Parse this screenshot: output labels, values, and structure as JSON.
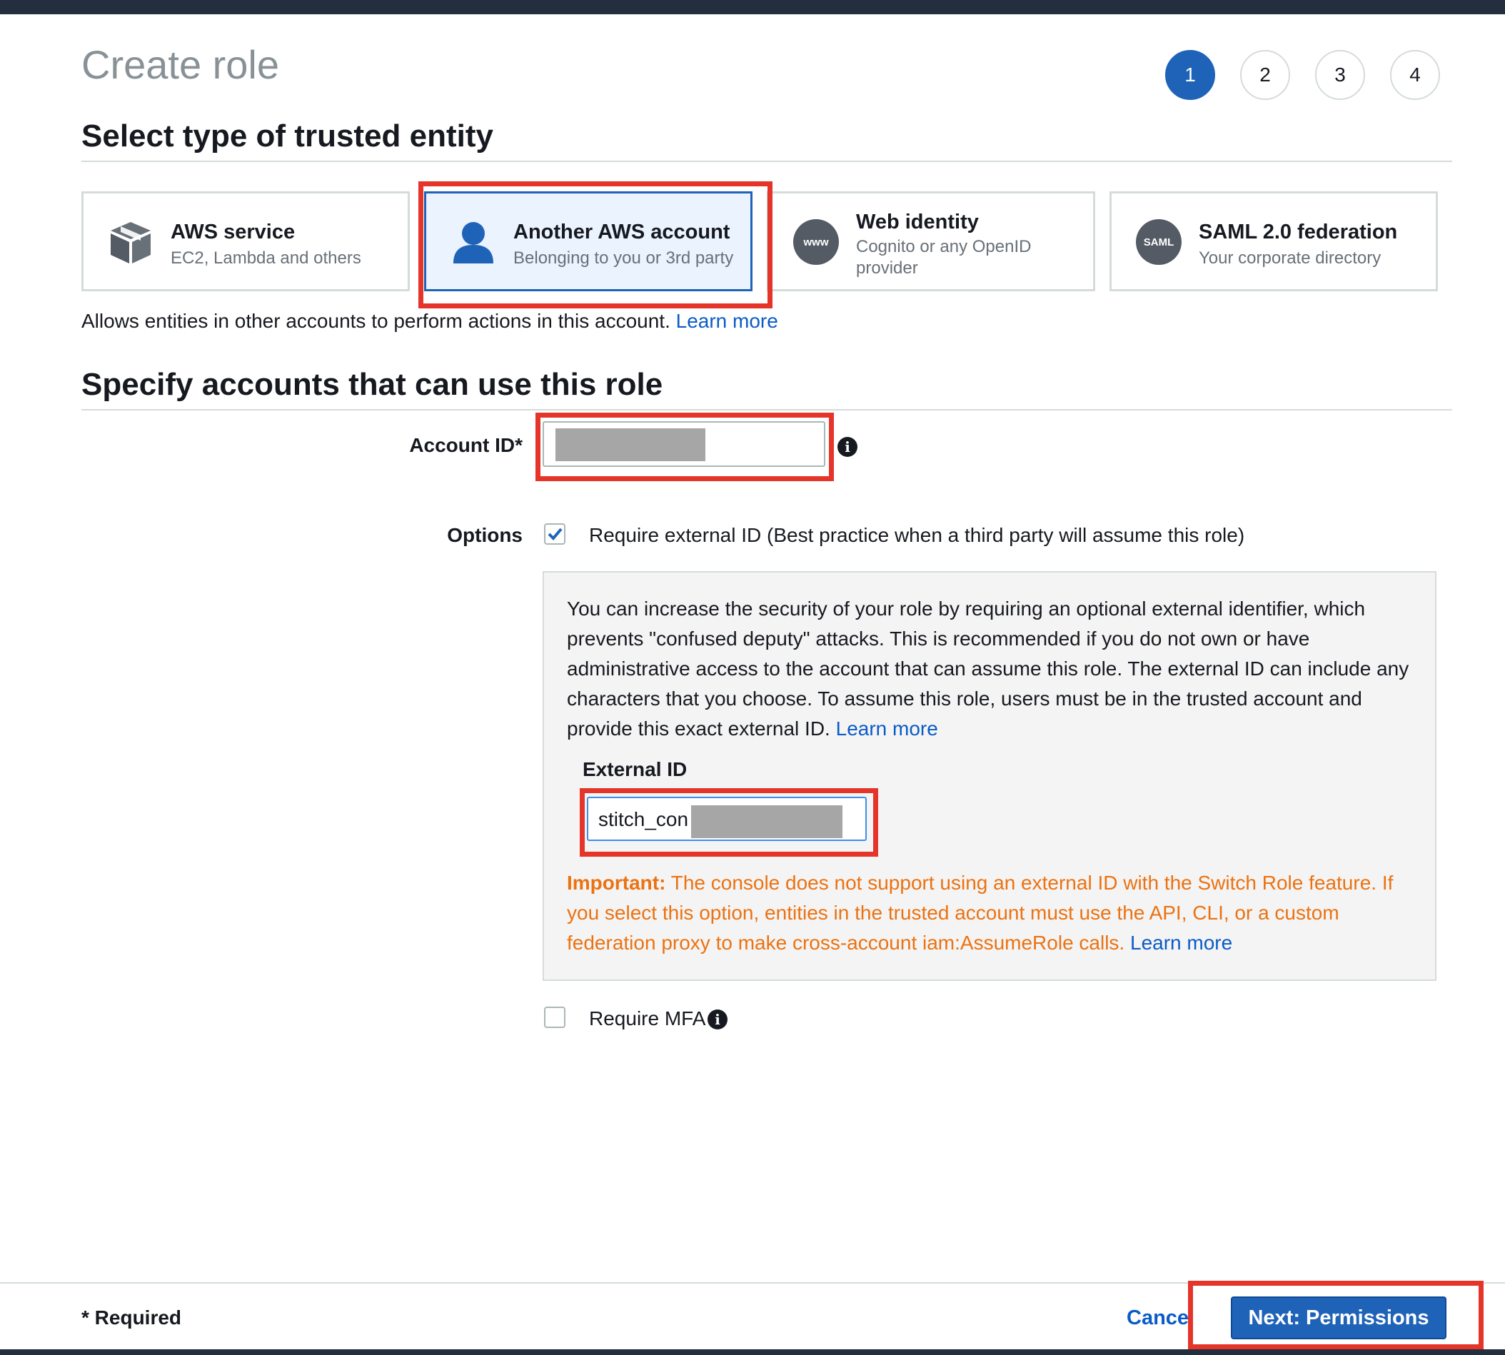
{
  "page": {
    "title": "Create role",
    "steps": [
      "1",
      "2",
      "3",
      "4"
    ],
    "active_step": "1"
  },
  "trusted_entity": {
    "heading": "Select type of trusted entity",
    "options": [
      {
        "title": "AWS service",
        "subtitle": "EC2, Lambda and others",
        "icon": "cube-icon",
        "selected": false
      },
      {
        "title": "Another AWS account",
        "subtitle": "Belonging to you or 3rd party",
        "icon": "user-icon",
        "selected": true
      },
      {
        "title": "Web identity",
        "subtitle": "Cognito or any OpenID",
        "subtitle2": "provider",
        "icon": "www-icon",
        "icon_text": "www",
        "selected": false
      },
      {
        "title": "SAML 2.0 federation",
        "subtitle": "Your corporate directory",
        "icon": "saml-icon",
        "icon_text": "SAML",
        "selected": false
      }
    ],
    "description": "Allows entities in other accounts to perform actions in this account.",
    "learn_more": "Learn more"
  },
  "accounts": {
    "heading": "Specify accounts that can use this role",
    "account_id_label": "Account ID*",
    "account_id_value": "",
    "options_label": "Options",
    "require_external_id": {
      "label": "Require external ID (Best practice when a third party will assume this role)",
      "checked": true
    },
    "external_panel": {
      "text": "You can increase the security of your role by requiring an optional external identifier, which prevents \"confused deputy\" attacks. This is recommended if you do not own or have administrative access to the account that can assume this role. The external ID can include any characters that you choose. To assume this role, users must be in the trusted account and provide this exact external ID.",
      "learn_more": "Learn more",
      "external_id_label": "External ID",
      "external_id_value": "stitch_con",
      "important_label": "Important:",
      "important_text": "The console does not support using an external ID with the Switch Role feature. If you select this option, entities in the trusted account must use the API, CLI, or a custom federation proxy to make cross-account iam:AssumeRole calls.",
      "important_learn_more": "Learn more"
    },
    "require_mfa": {
      "label": "Require MFA",
      "checked": false
    }
  },
  "footer": {
    "required_note": "* Required",
    "cancel_label": "Cancel",
    "next_label": "Next: Permissions"
  },
  "colors": {
    "primary": "#1f63b8",
    "link": "#0b5bc7",
    "warning": "#ec7211",
    "highlight": "#e5352a",
    "header": "#232f3e"
  }
}
